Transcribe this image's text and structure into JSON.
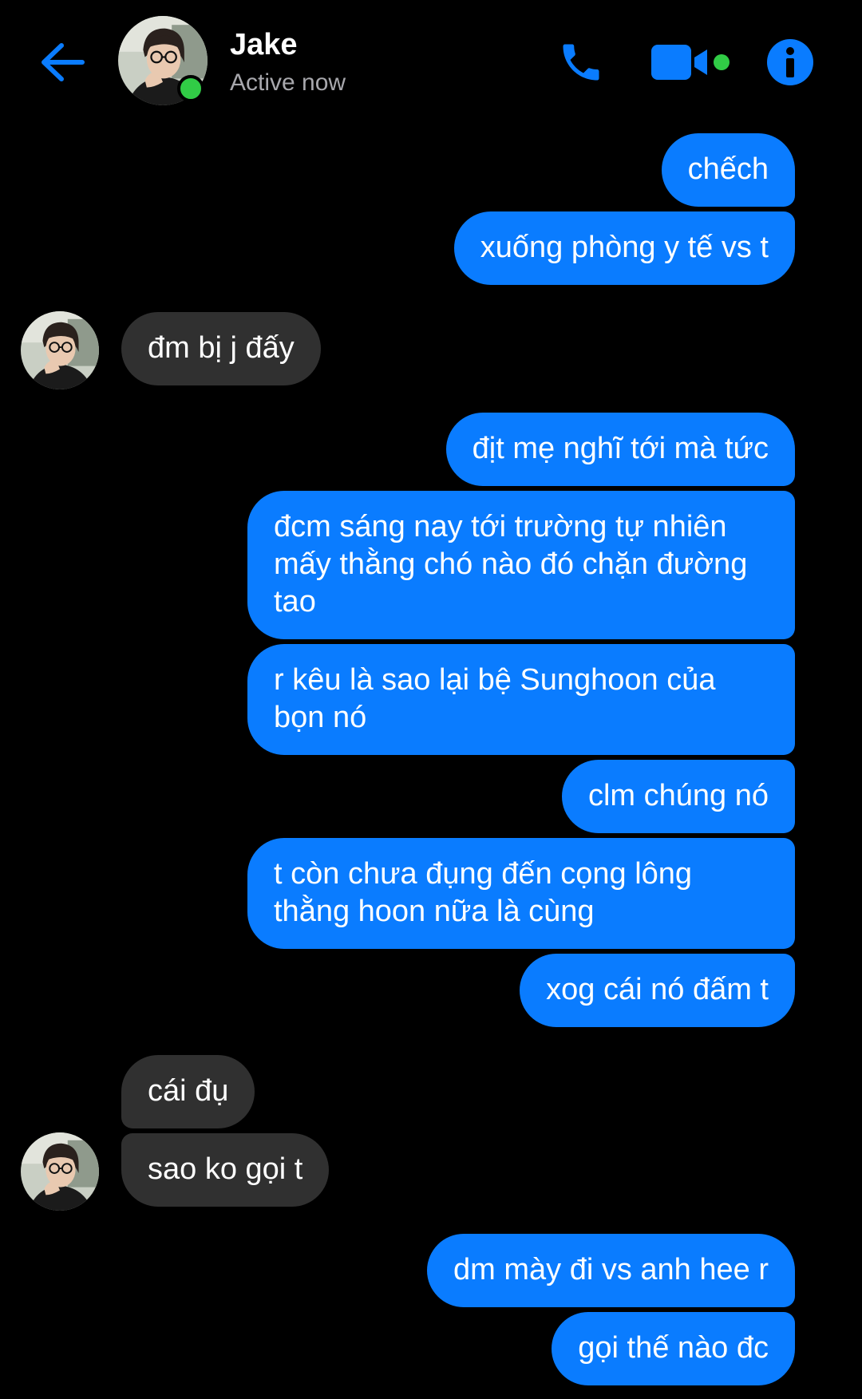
{
  "header": {
    "name": "Jake",
    "status": "Active now",
    "back_icon": "arrow-left-icon",
    "call_icon": "phone-icon",
    "video_icon": "video-camera-icon",
    "info_icon": "info-icon",
    "accent_color": "#0a7cff",
    "online_color": "#31cc46"
  },
  "messages": [
    {
      "sender": "me",
      "text": "chếch"
    },
    {
      "sender": "me",
      "text": "xuống phòng y tế vs t"
    },
    {
      "sender": "them",
      "text": "đm bị j đấy"
    },
    {
      "sender": "me",
      "text": "địt mẹ nghĩ tới mà tức"
    },
    {
      "sender": "me",
      "text": "đcm sáng nay tới trường tự nhiên mấy thằng chó nào đó chặn đường tao"
    },
    {
      "sender": "me",
      "text": "r kêu là sao lại bệ Sunghoon của bọn nó"
    },
    {
      "sender": "me",
      "text": "clm chúng nó"
    },
    {
      "sender": "me",
      "text": "t còn chưa đụng đến cọng lông thằng hoon nữa là cùng"
    },
    {
      "sender": "me",
      "text": "xog cái nó đấm t"
    },
    {
      "sender": "them",
      "text": "cái đụ"
    },
    {
      "sender": "them",
      "text": "sao ko gọi t"
    },
    {
      "sender": "me",
      "text": "dm mày đi vs anh hee r"
    },
    {
      "sender": "me",
      "text": "gọi thế nào đc"
    }
  ],
  "colors": {
    "outgoing_bubble": "#0a7cff",
    "incoming_bubble": "#303030",
    "background": "#000000"
  }
}
